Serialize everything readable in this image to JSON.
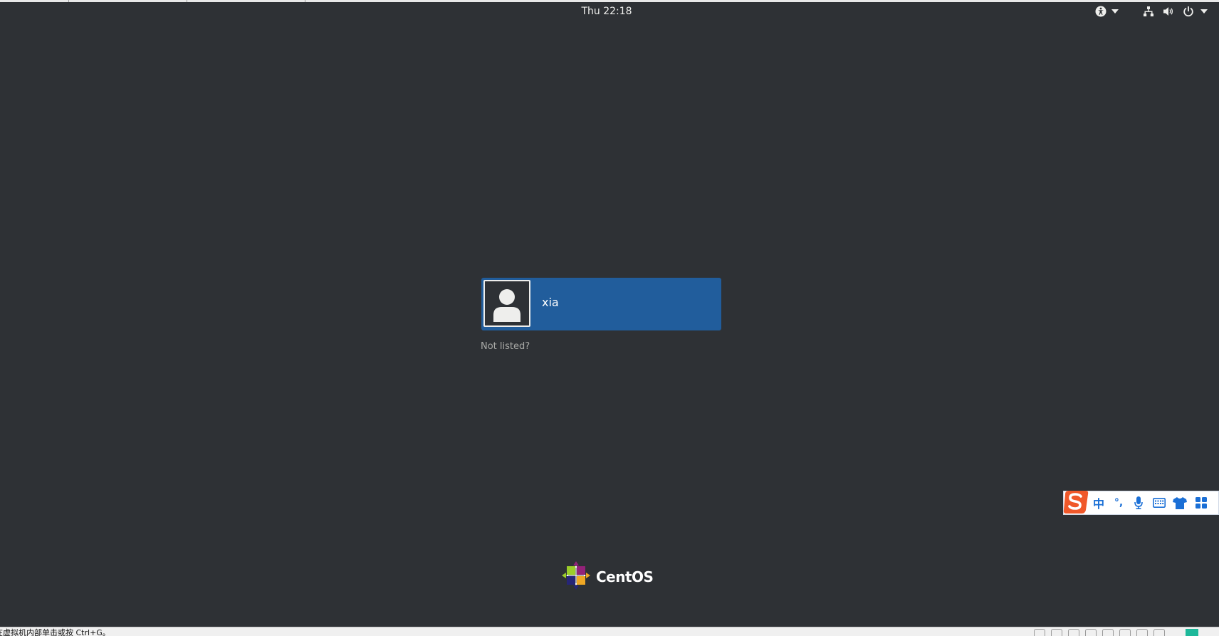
{
  "top_bar": {
    "clock": "Thu 22:18",
    "tray_icons": [
      "accessibility-icon",
      "chevron-down-icon",
      "network-icon",
      "volume-icon",
      "power-icon",
      "chevron-down-icon"
    ]
  },
  "login": {
    "username": "xia",
    "not_listed_label": "Not listed?",
    "avatar_icon": "user-avatar-icon",
    "card_color": "#215d9c"
  },
  "branding": {
    "logo_text": "CentOS",
    "logo_icon": "centos-logo-icon"
  },
  "ime_toolbar": {
    "logo_icon": "sogou-logo-icon",
    "mode_label": "中",
    "punctuation_label": "°,",
    "items": [
      "microphone-icon",
      "keyboard-icon",
      "skin-icon",
      "toolbox-icon"
    ],
    "accent": "#1a6fd6"
  },
  "vm_status_bar": {
    "hint_text": "要将输入定向到该虚拟机，请在虚拟机内部单击或按 Ctrl+G。",
    "icons": [
      "hard-disk-icon",
      "cd-icon",
      "network-adapter-icon",
      "usb-icon",
      "sound-icon",
      "printer-icon",
      "display-icon",
      "display-icon"
    ]
  }
}
